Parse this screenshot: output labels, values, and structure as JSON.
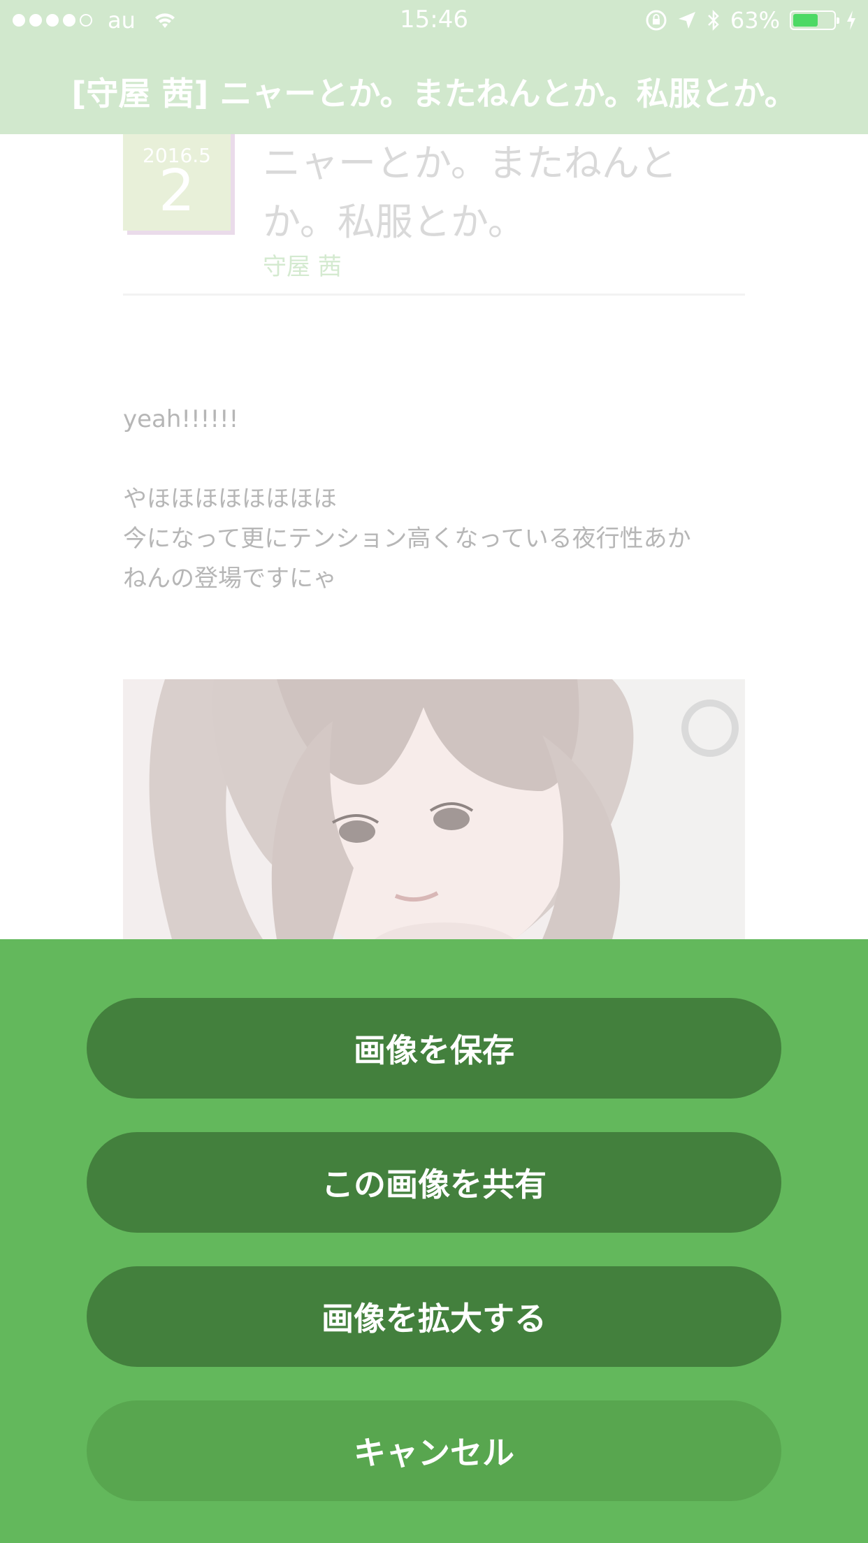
{
  "status_bar": {
    "carrier": "au",
    "time": "15:46",
    "battery_percent": "63%",
    "battery_level": 0.63,
    "signal_bars": 4,
    "signal_max": 5,
    "battery_color": "#4cd964"
  },
  "nav": {
    "title": "[守屋 茜] ニャーとか。またねんとか。私服とか。"
  },
  "post": {
    "date_year_month": "2016.5",
    "date_day": "2",
    "title": "ニャーとか。またねんとか。私服とか。",
    "author": "守屋 茜",
    "paragraphs": [
      "yeah!!!!!!",
      "やほほほほほほほほ",
      "今になって更にテンション高くなっている夜行性あか",
      "ねんの登場ですにゃ"
    ],
    "image_icon": "photo-image"
  },
  "action_sheet": {
    "save_label": "画像を保存",
    "share_label": "この画像を共有",
    "zoom_label": "画像を拡大する",
    "cancel_label": "キャンセル",
    "background_color": "#63b85c",
    "button_color": "#43803d",
    "cancel_color": "#58a64f"
  },
  "icons": [
    "wifi-icon",
    "orientation-lock-icon",
    "location-icon",
    "bluetooth-icon",
    "battery-icon",
    "charging-icon"
  ]
}
